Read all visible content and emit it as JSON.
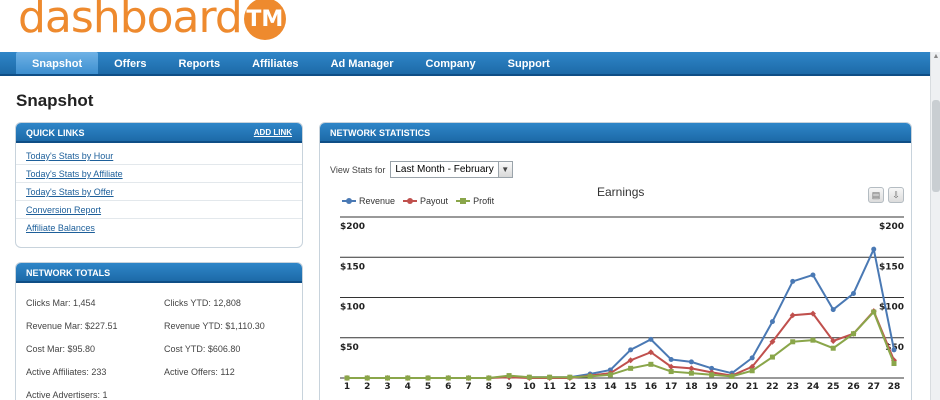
{
  "logo": {
    "text": "dashboard",
    "tm": "TM"
  },
  "nav": {
    "items": [
      {
        "label": "Snapshot",
        "name": "nav-snapshot"
      },
      {
        "label": "Offers",
        "name": "nav-offers"
      },
      {
        "label": "Reports",
        "name": "nav-reports"
      },
      {
        "label": "Affiliates",
        "name": "nav-affiliates"
      },
      {
        "label": "Ad Manager",
        "name": "nav-ad-manager"
      },
      {
        "label": "Company",
        "name": "nav-company"
      },
      {
        "label": "Support",
        "name": "nav-support"
      }
    ],
    "active": "Snapshot"
  },
  "page": {
    "title": "Snapshot"
  },
  "quick_links": {
    "title": "QUICK LINKS",
    "add_link": "ADD LINK",
    "items": [
      "Today's Stats by Hour",
      "Today's Stats by Affiliate",
      "Today's Stats by Offer",
      "Conversion Report",
      "Affiliate Balances"
    ]
  },
  "network_totals": {
    "title": "NETWORK TOTALS",
    "clicks_mar": "Clicks Mar: 1,454",
    "clicks_ytd": "Clicks YTD: 12,808",
    "revenue_mar": "Revenue Mar: $227.51",
    "revenue_ytd": "Revenue YTD: $1,110.30",
    "cost_mar": "Cost Mar: $95.80",
    "cost_ytd": "Cost YTD: $606.80",
    "active_affiliates": "Active Affiliates: 233",
    "active_offers": "Active Offers: 112",
    "active_advertisers": "Active Advertisers: 1"
  },
  "network_stats": {
    "title": "NETWORK STATISTICS",
    "view_label": "View Stats for",
    "selected_period": "Last Month - February"
  },
  "chart_data": {
    "type": "line",
    "title": "Earnings",
    "x": [
      1,
      2,
      3,
      4,
      5,
      6,
      7,
      8,
      9,
      10,
      11,
      12,
      13,
      14,
      15,
      16,
      17,
      18,
      19,
      20,
      21,
      22,
      23,
      24,
      25,
      26,
      27,
      28
    ],
    "ylim": [
      0,
      200
    ],
    "yticks": [
      "$50",
      "$100",
      "$150",
      "$200"
    ],
    "grid": true,
    "legend": "top-left",
    "series": [
      {
        "name": "Revenue",
        "color": "#4a79b4",
        "values": [
          0,
          0,
          0,
          0,
          0,
          0,
          0,
          0,
          2,
          1,
          1,
          1,
          5,
          10,
          35,
          48,
          23,
          20,
          12,
          6,
          25,
          70,
          120,
          128,
          85,
          105,
          160,
          35
        ]
      },
      {
        "name": "Payout",
        "color": "#c0504d",
        "values": [
          0,
          0,
          0,
          0,
          0,
          0,
          0,
          0,
          1,
          0,
          0,
          0,
          3,
          6,
          22,
          32,
          14,
          12,
          7,
          3,
          14,
          45,
          78,
          80,
          46,
          55,
          83,
          22
        ]
      },
      {
        "name": "Profit",
        "color": "#8aa64a",
        "values": [
          0,
          0,
          0,
          0,
          0,
          0,
          0,
          0,
          3,
          1,
          1,
          1,
          2,
          4,
          12,
          17,
          8,
          6,
          4,
          2,
          9,
          26,
          45,
          47,
          37,
          55,
          82,
          18
        ]
      }
    ]
  }
}
